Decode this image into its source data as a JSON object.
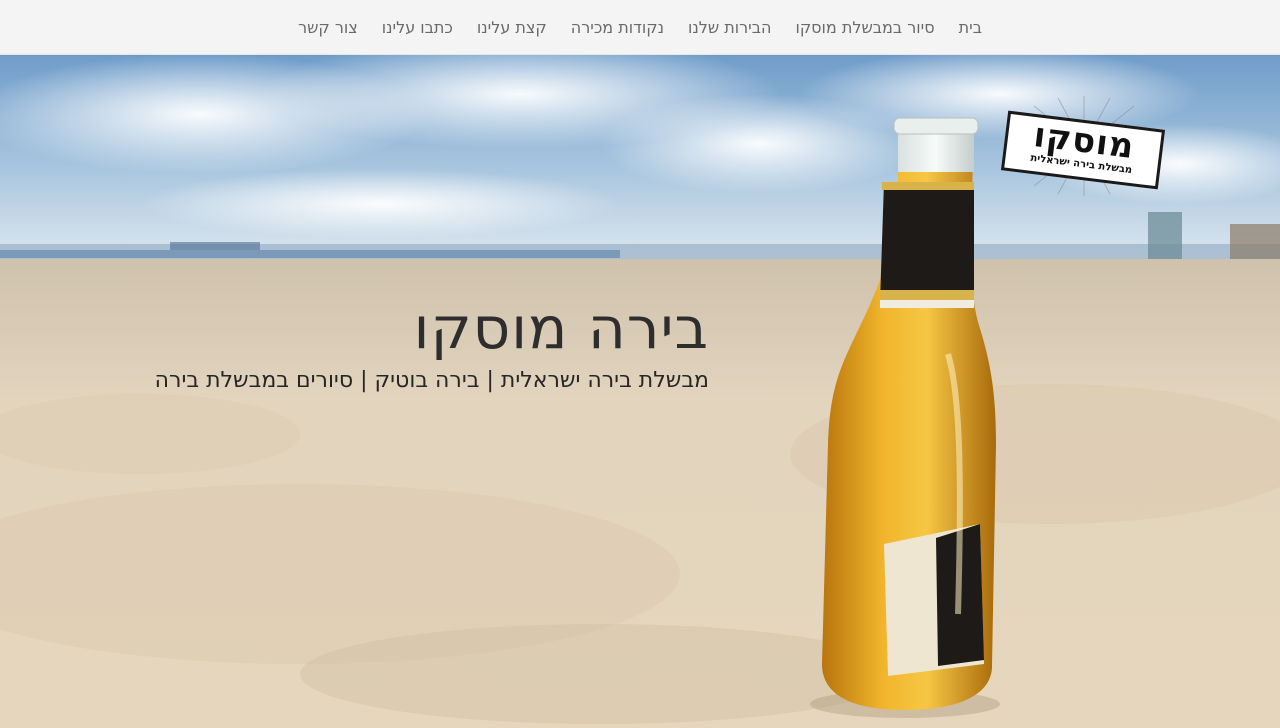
{
  "nav": {
    "items": [
      {
        "label": "בית"
      },
      {
        "label": "סיור במבשלת מוסקו"
      },
      {
        "label": "הבירות שלנו"
      },
      {
        "label": "נקודות מכירה"
      },
      {
        "label": "קצת עלינו"
      },
      {
        "label": "כתבו עלינו"
      },
      {
        "label": "צור קשר"
      }
    ]
  },
  "hero": {
    "title": "בירה מוסקו",
    "subtitle": "מבשלת בירה ישראלית | בירה בוטיק | סיורים במבשלת בירה"
  },
  "logo": {
    "main_text": "מוסקו",
    "sub_text": "מבשלת בירה ישראלית"
  },
  "colors": {
    "nav_bg": "#f4f4f4",
    "nav_text": "#6a6a6a",
    "hero_text": "#2e2e2e",
    "sand": "#e9dcc6",
    "sky": "#9fc0dc"
  }
}
